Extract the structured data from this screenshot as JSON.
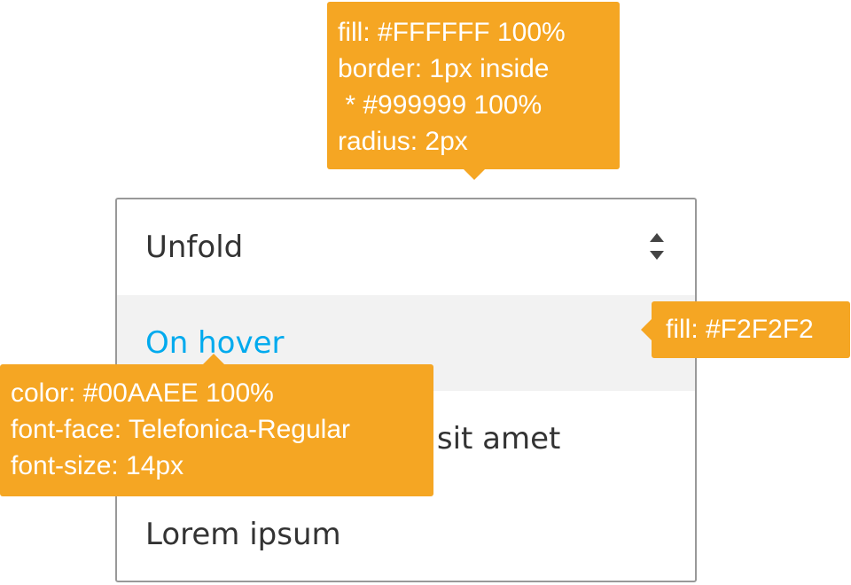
{
  "dropdown": {
    "header_label": "Unfold",
    "options": [
      "On hover",
      "Lorem ipsum dolor sit amet",
      "Lorem ipsum"
    ]
  },
  "annotations": {
    "container": [
      "fill: #FFFFFF 100%",
      "border: 1px inside",
      " * #999999 100%",
      "radius: 2px"
    ],
    "hover_fill": "fill: #F2F2F2",
    "hover_text": [
      "color: #00AAEE 100%",
      "font-face: Telefonica-Regular",
      "font-size: 14px"
    ]
  },
  "colors": {
    "accent": "#00AAEE",
    "annotation": "#F5A623",
    "hover_bg": "#F2F2F2",
    "border": "#999999"
  }
}
